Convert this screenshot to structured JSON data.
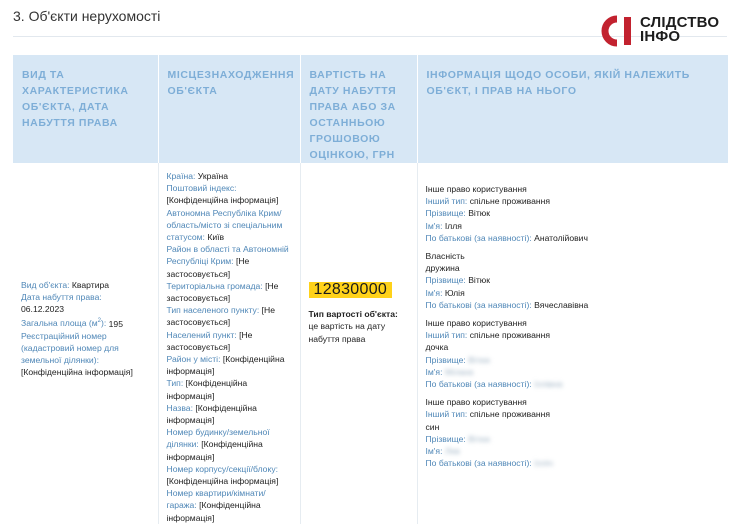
{
  "section_title": "3. Об'єкти нерухомості",
  "logo": {
    "line1": "СЛІДСТВО",
    "line2": "ІНФО",
    "accent": "#c2222f"
  },
  "columns": [
    "Вид та характеристика об'єкта, дата набуття права",
    "Місцезнаходження об'єкта",
    "Вартість на дату набуття права або за останньою грошовою оцінкою, грн",
    "Інформація щодо особи, якій належить об'єкт, і прав на нього"
  ],
  "object": {
    "type_label": "Вид об'єкта:",
    "type_value": "Квартира",
    "date_label": "Дата набуття права:",
    "date_value": "06.12.2023",
    "area_label": "Загальна площа (м",
    "area_sup": "2",
    "area_suffix": "):",
    "area_value": "195",
    "cadastre_label": "Реєстраційний номер (кадастровий номер для земельної ділянки):",
    "cadastre_value": "[Конфіденційна інформація]"
  },
  "location": [
    {
      "k": "Країна:",
      "v": "Україна"
    },
    {
      "k": "Поштовий індекс:",
      "v": "[Конфіденційна інформація]"
    },
    {
      "k": "Автономна Республіка Крим/ область/місто зі спеціальним статусом:",
      "v": "Київ"
    },
    {
      "k": "Район в області та Автономній Республіці Крим:",
      "v": "[Не застосовується]"
    },
    {
      "k": "Територіальна громада:",
      "v": "[Не застосовується]"
    },
    {
      "k": "Тип населеного пункту:",
      "v": "[Не застосовується]"
    },
    {
      "k": "Населений пункт:",
      "v": "[Не застосовується]"
    },
    {
      "k": "Район у місті:",
      "v": "[Конфіденційна інформація]"
    },
    {
      "k": "Тип:",
      "v": "[Конфіденційна інформація]"
    },
    {
      "k": "Назва:",
      "v": "[Конфіденційна інформація]"
    },
    {
      "k": "Номер будинку/земельної ділянки:",
      "v": "[Конфіденційна інформація]"
    },
    {
      "k": "Номер корпусу/секції/блоку:",
      "v": "[Конфіденційна інформація]"
    },
    {
      "k": "Номер квартири/кімнати/гаража:",
      "v": "[Конфіденційна інформація]"
    }
  ],
  "value": {
    "amount": "12830000",
    "type_label": "Тип вартості об'єкта:",
    "type_value": "це вартість на дату набуття права"
  },
  "owners": {
    "rights_1": "Інше право користування",
    "other_type_1": {
      "k": "Інший тип:",
      "v": "спільне проживання"
    },
    "surname_1": {
      "k": "Прізвище:",
      "v": "Вітюк"
    },
    "name_1": {
      "k": "Ім'я:",
      "v": "Ілля"
    },
    "patronymic_1": {
      "k": "По батькові (за наявності):",
      "v": "Анатолійович"
    },
    "rights_2": "Власність",
    "relation_2": "дружина",
    "surname_2": {
      "k": "Прізвище:",
      "v": "Вітюк"
    },
    "name_2": {
      "k": "Ім'я:",
      "v": "Юлія"
    },
    "patronymic_2": {
      "k": "По батькові (за наявності):",
      "v": "Вячеславівна"
    },
    "rights_3": "Інше право користування",
    "other_type_3": {
      "k": "Інший тип:",
      "v": "спільне проживання"
    },
    "relation_3": "дочка",
    "surname_3": {
      "k": "Прізвище:",
      "v": "Вітюк"
    },
    "name_3": {
      "k": "Ім'я:",
      "v": "Мілана"
    },
    "patronymic_3": {
      "k": "По батькові (за наявності):",
      "v": "Іллівна"
    },
    "rights_4": "Інше право користування",
    "other_type_4": {
      "k": "Інший тип:",
      "v": "спільне проживання"
    },
    "relation_4": "син",
    "surname_4": {
      "k": "Прізвище:",
      "v": "Вітюк"
    },
    "name_4": {
      "k": "Ім'я:",
      "v": "Лев"
    },
    "patronymic_4": {
      "k": "По батькові (за наявності):",
      "v": "Ілліч"
    }
  }
}
